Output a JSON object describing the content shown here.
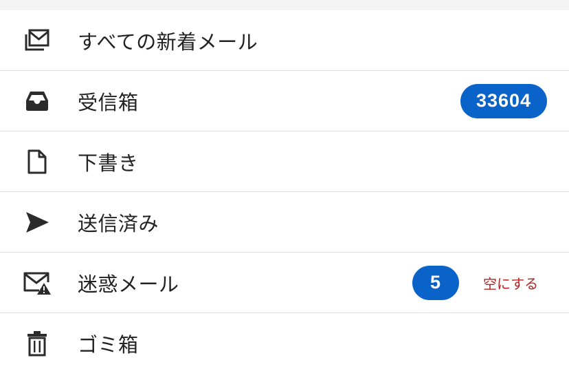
{
  "folders": [
    {
      "label": "すべての新着メール",
      "icon": "all-mail-icon"
    },
    {
      "label": "受信箱",
      "icon": "inbox-tray-icon",
      "count": "33604"
    },
    {
      "label": "下書き",
      "icon": "document-icon"
    },
    {
      "label": "送信済み",
      "icon": "send-icon"
    },
    {
      "label": "迷惑メール",
      "icon": "spam-mail-warning-icon",
      "count": "5",
      "action": "空にする"
    },
    {
      "label": "ゴミ箱",
      "icon": "trash-icon"
    }
  ],
  "colors": {
    "badge": "#0a63c9",
    "action": "#b22424",
    "text": "#222222",
    "divider": "#dedede"
  }
}
